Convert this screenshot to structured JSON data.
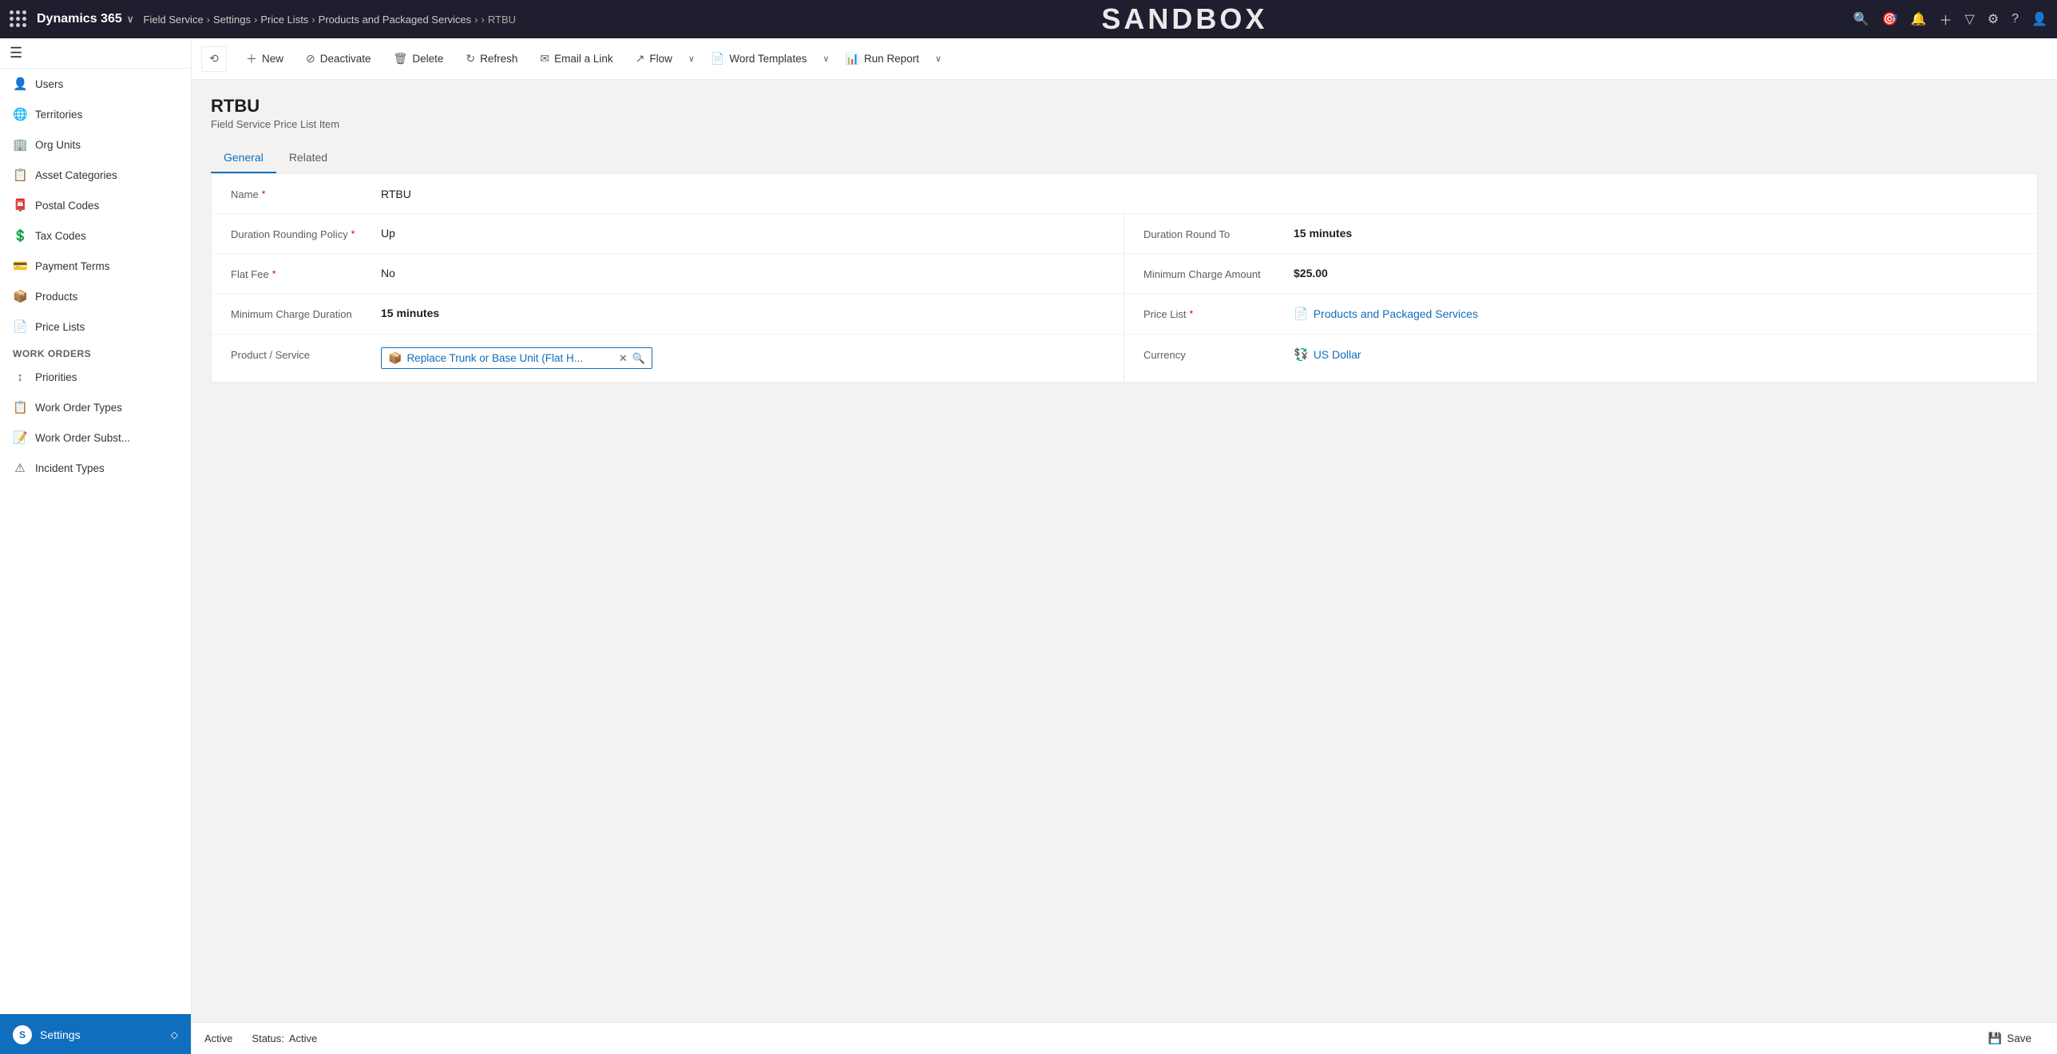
{
  "topNav": {
    "dotsLabel": "App launcher",
    "appName": "Dynamics 365",
    "module": "Field Service",
    "breadcrumb": [
      "Settings",
      "Price Lists",
      "Products and Packaged Services",
      "RTBU"
    ],
    "sandboxText": "SANDBOX"
  },
  "toolbar": {
    "historyLabel": "Navigate back",
    "newLabel": "New",
    "deactivateLabel": "Deactivate",
    "deleteLabel": "Delete",
    "refreshLabel": "Refresh",
    "emailLinkLabel": "Email a Link",
    "flowLabel": "Flow",
    "wordTemplatesLabel": "Word Templates",
    "runReportLabel": "Run Report"
  },
  "page": {
    "title": "RTBU",
    "subtitle": "Field Service Price List Item",
    "tabs": [
      "General",
      "Related"
    ]
  },
  "form": {
    "fields": {
      "name": {
        "label": "Name",
        "required": true,
        "value": "RTBU"
      },
      "durationRoundingPolicy": {
        "label": "Duration Rounding Policy",
        "required": true,
        "value": "Up"
      },
      "durationRoundTo": {
        "label": "Duration Round To",
        "value": "15 minutes"
      },
      "flatFee": {
        "label": "Flat Fee",
        "required": true,
        "value": "No"
      },
      "minimumChargeAmount": {
        "label": "Minimum Charge Amount",
        "value": "$25.00"
      },
      "minimumChargeDuration": {
        "label": "Minimum Charge Duration",
        "value": "15 minutes"
      },
      "priceList": {
        "label": "Price List",
        "required": true,
        "value": "Products and Packaged Services"
      },
      "productService": {
        "label": "Product / Service",
        "value": "Replace Trunk or Base Unit (Flat H..."
      },
      "currency": {
        "label": "Currency",
        "value": "US Dollar"
      }
    }
  },
  "sidebar": {
    "items": [
      {
        "icon": "👤",
        "label": "Users",
        "name": "users"
      },
      {
        "icon": "🌐",
        "label": "Territories",
        "name": "territories"
      },
      {
        "icon": "🏢",
        "label": "Org Units",
        "name": "org-units"
      },
      {
        "icon": "📋",
        "label": "Asset Categories",
        "name": "asset-categories"
      },
      {
        "icon": "📮",
        "label": "Postal Codes",
        "name": "postal-codes"
      },
      {
        "icon": "💲",
        "label": "Tax Codes",
        "name": "tax-codes"
      },
      {
        "icon": "💳",
        "label": "Payment Terms",
        "name": "payment-terms"
      },
      {
        "icon": "📦",
        "label": "Products",
        "name": "products"
      },
      {
        "icon": "📄",
        "label": "Price Lists",
        "name": "price-lists"
      }
    ],
    "workOrdersSection": "Work Orders",
    "workOrderItems": [
      {
        "icon": "↕",
        "label": "Priorities",
        "name": "priorities"
      },
      {
        "icon": "📋",
        "label": "Work Order Types",
        "name": "work-order-types"
      },
      {
        "icon": "📝",
        "label": "Work Order Subst...",
        "name": "work-order-subst"
      },
      {
        "icon": "⚠",
        "label": "Incident Types",
        "name": "incident-types"
      }
    ],
    "footerLabel": "Settings",
    "footerInitial": "S"
  },
  "statusBar": {
    "statusLabel": "Active",
    "statusText": "Status:",
    "statusValue": "Active",
    "saveLabel": "Save"
  }
}
